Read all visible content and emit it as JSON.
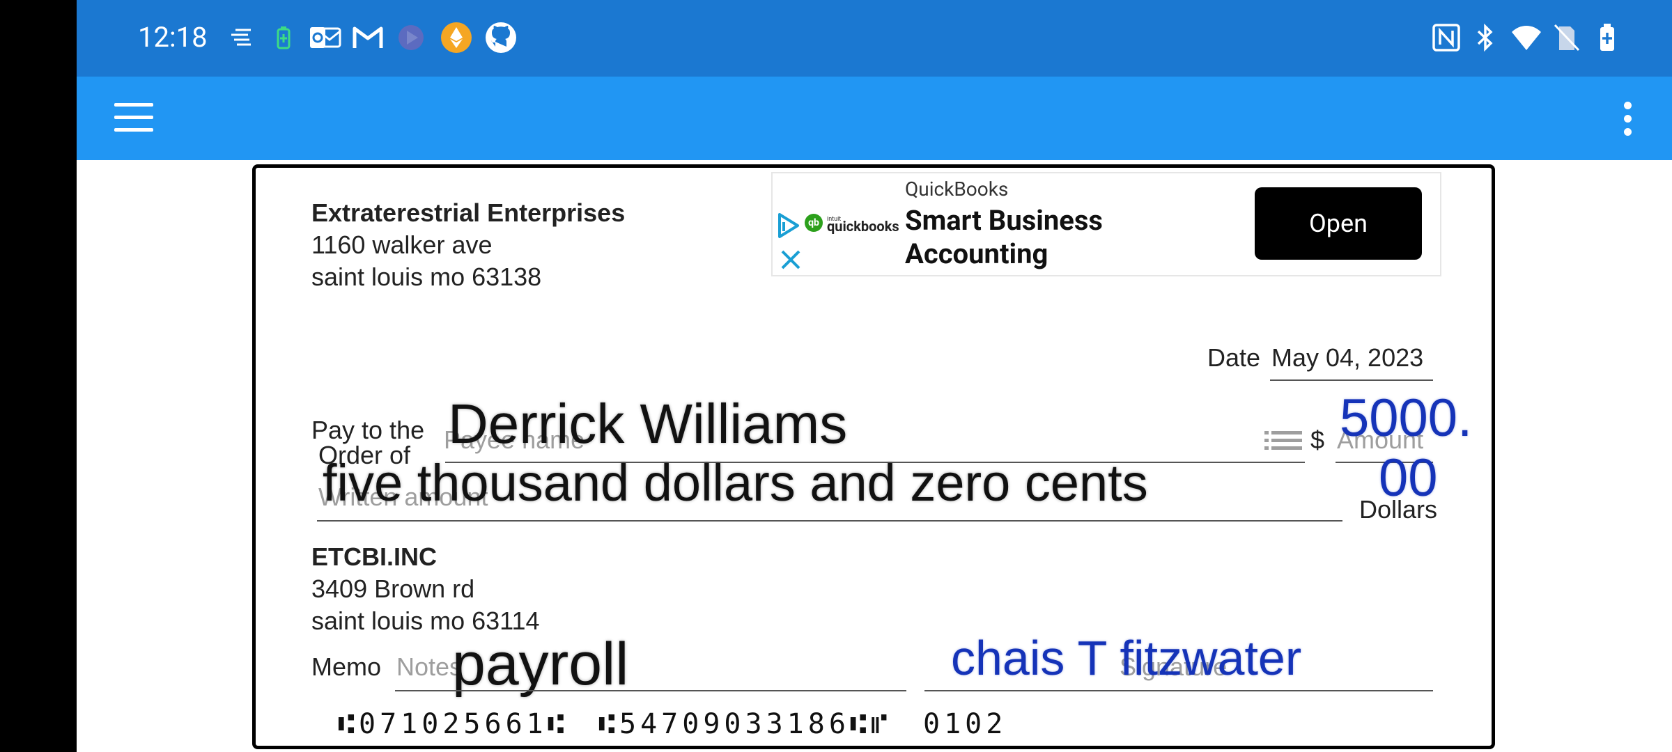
{
  "status_bar": {
    "time": "12:18",
    "left_icons": [
      "notification-lines-icon",
      "battery-saver-icon",
      "outlook-icon",
      "gmail-icon",
      "generic-app-icon",
      "ethereum-icon",
      "github-icon"
    ],
    "right_icons": [
      "nfc-icon",
      "bluetooth-icon",
      "wifi-icon",
      "no-sim-icon",
      "battery-charging-icon"
    ]
  },
  "app_bar": {
    "menu_icon": "hamburger-menu-icon",
    "overflow_icon": "more-vertical-icon"
  },
  "ad": {
    "brand": "QuickBooks",
    "title": "Smart Business Accounting",
    "cta": "Open",
    "logo_text": "quickbooks",
    "logo_small": "intuit",
    "colors": {
      "accent": "#2ca01c",
      "play": "#1a9fd4"
    }
  },
  "check": {
    "payer": {
      "name": "Extraterestrial Enterprises",
      "address_line1": "1160 walker ave",
      "address_line2": "saint louis mo 63138"
    },
    "date_label": "Date",
    "date_value": "May 04, 2023",
    "pay_to_label_1": "Pay to the",
    "pay_to_label_2": "Order of",
    "payee_placeholder": "Payee name",
    "payee_value": "Derrick Williams",
    "dollar_sign": "$",
    "amount_placeholder": "Amount",
    "amount_value_line1": "5000.",
    "amount_value_line2": "00",
    "written_placeholder": "Written amount",
    "written_value": "five thousand dollars and zero cents",
    "dollars_label": "Dollars",
    "bank": {
      "name": "ETCBI.INC",
      "address_line1": "3409 Brown rd",
      "address_line2": "saint louis mo 63114"
    },
    "memo_label": "Memo",
    "memo_placeholder": "Notes",
    "memo_value": "payroll",
    "signature_placeholder": "Signature",
    "signature_value": "chais T fitzwater",
    "micr_routing": "⑆071025661⑆",
    "micr_account": "⑆54709033186⑆⑈",
    "micr_check": "0102"
  }
}
